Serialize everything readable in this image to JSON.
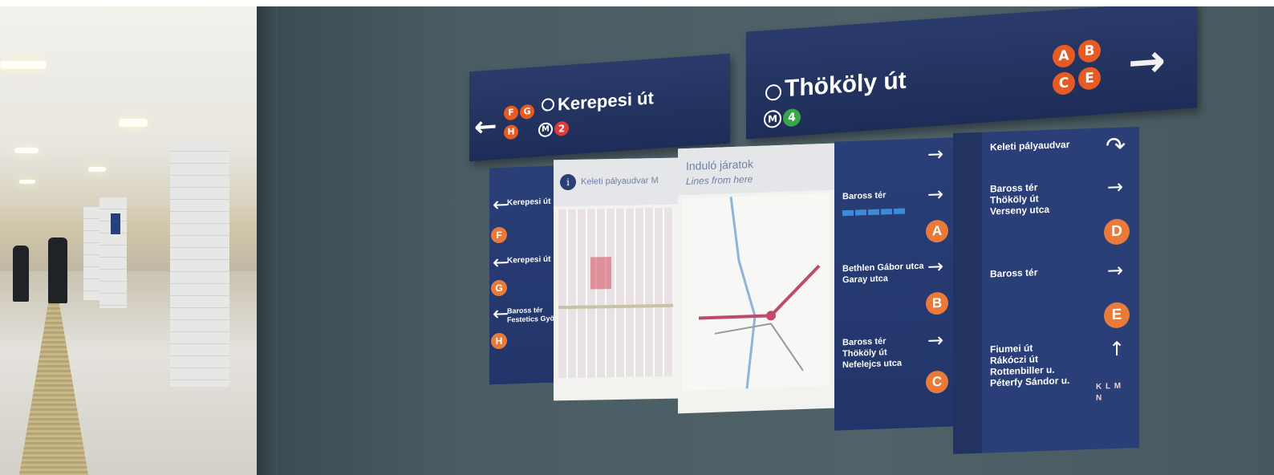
{
  "signs": {
    "left": {
      "station": "Kerepesi út",
      "exits": [
        "F",
        "G",
        "H"
      ],
      "metro_line": "2",
      "metro_color": "#e03a3a",
      "arrow_icon": "arrow-left-icon"
    },
    "right": {
      "station": "Thököly út",
      "exits": [
        "A",
        "B",
        "C",
        "E"
      ],
      "metro_line": "4",
      "metro_color": "#3aa64a",
      "arrow_icon": "arrow-right-icon"
    }
  },
  "board": {
    "map_panel": {
      "title": "Keleti pályaudvar M",
      "info_icon": "info-icon"
    },
    "lines_panel": {
      "title": "Induló járatok",
      "subtitle": "Lines from here"
    },
    "left_column": {
      "entries": [
        {
          "text": "Kerepesi út",
          "exit": "F"
        },
        {
          "text": "Kerepesi út",
          "exit": "G"
        },
        {
          "text": "Baross tér\nFestetics György u.",
          "exit": "H"
        }
      ]
    },
    "middle_column": {
      "entries": [
        {
          "text": "Baross tér",
          "exit": "A"
        },
        {
          "text": "Bethlen Gábor utca\nGaray utca",
          "exit": "B"
        },
        {
          "text": "Baross tér\nThököly út\nNefelejcs utca",
          "exit": "C"
        }
      ]
    },
    "right_column": {
      "entries": [
        {
          "text": "Keleti pályaudvar",
          "exit": "",
          "arrow": "u-turn-icon"
        },
        {
          "text": "Baross tér\nThököly út\nVerseny utca",
          "exit": "D",
          "arrow": "arrow-right-icon"
        },
        {
          "text": "Baross tér",
          "exit": "E",
          "arrow": "arrow-right-icon"
        },
        {
          "text": "Fiumei út\nRákóczi út\nRottenbiller u.\nPéterfy Sándor u.",
          "exit": "K L M N",
          "arrow": "arrow-up-icon"
        }
      ]
    }
  },
  "colors": {
    "sign_blue": "#22315f",
    "exit_orange": "#e65a24",
    "wall": "#4a5c63"
  }
}
